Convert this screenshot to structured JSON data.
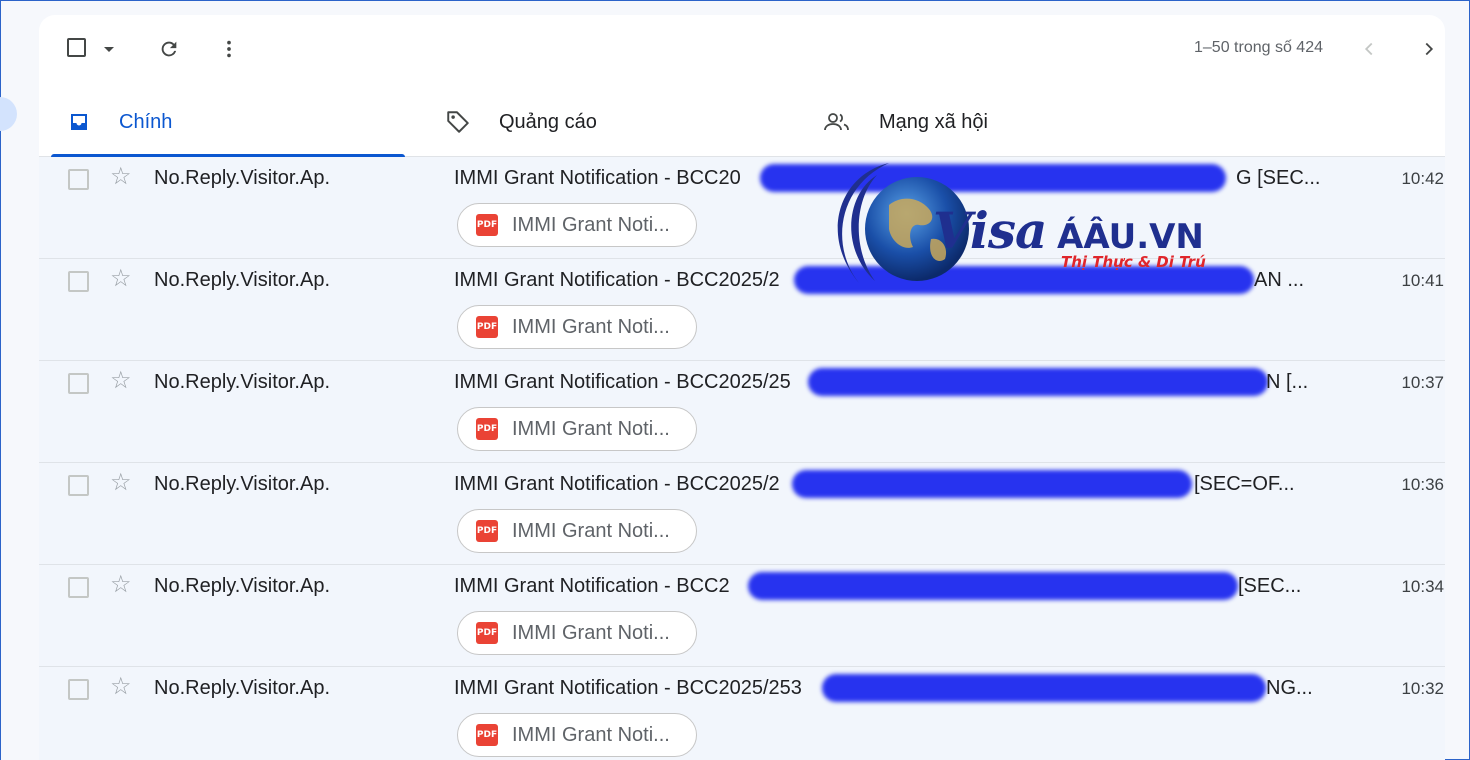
{
  "toolbar": {
    "pager": "1–50 trong số 424"
  },
  "tabs": [
    {
      "label": "Chính",
      "icon": "inbox-icon"
    },
    {
      "label": "Quảng cáo",
      "icon": "tag-icon"
    },
    {
      "label": "Mạng xã hội",
      "icon": "people-icon"
    }
  ],
  "rows": [
    {
      "sender": "No.Reply.Visitor.Ap.",
      "subject_start": "IMMI Grant Notification - BCC20",
      "subject_end": "G [SEC...",
      "attachment": "IMMI Grant Noti...",
      "time": "10:42"
    },
    {
      "sender": "No.Reply.Visitor.Ap.",
      "subject_start": "IMMI Grant Notification - BCC2025/2",
      "subject_end": "AN ...",
      "attachment": "IMMI Grant Noti...",
      "time": "10:41"
    },
    {
      "sender": "No.Reply.Visitor.Ap.",
      "subject_start": "IMMI Grant Notification - BCC2025/25",
      "subject_end": "N [...",
      "attachment": "IMMI Grant Noti...",
      "time": "10:37"
    },
    {
      "sender": "No.Reply.Visitor.Ap.",
      "subject_start": "IMMI Grant Notification - BCC2025/2",
      "subject_end": "[SEC=OF...",
      "attachment": "IMMI Grant Noti...",
      "time": "10:36"
    },
    {
      "sender": "No.Reply.Visitor.Ap.",
      "subject_start": "IMMI Grant Notification - BCC2",
      "subject_end": "[SEC...",
      "attachment": "IMMI Grant Noti...",
      "time": "10:34"
    },
    {
      "sender": "No.Reply.Visitor.Ap.",
      "subject_start": "IMMI Grant Notification - BCC2025/253",
      "subject_end": "NG...",
      "attachment": "IMMI Grant Noti...",
      "time": "10:32"
    }
  ],
  "attachment_badge": "PDF",
  "watermark": {
    "brand": "Visa",
    "domain": "ÁÂU.VN",
    "tagline": "Thị Thực & Di Trú"
  }
}
